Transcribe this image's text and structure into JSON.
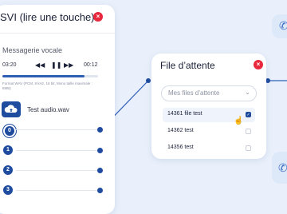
{
  "svi": {
    "title": "SVI (lire une touche)",
    "close_icon": "×",
    "voicemail_label": "Messagerie vocale",
    "time_start": "03:20",
    "time_end": "00:12",
    "progress": 0.86,
    "format_text": "Format WAV (PCM, 8 kHz, 16 bit, Mono taille maximale : 8MB)",
    "file_name": "Test audio.wav",
    "keys": [
      "0",
      "1",
      "2",
      "3"
    ],
    "controls": {
      "prev": "◀◀",
      "pause": "❚❚",
      "next": "▶▶"
    }
  },
  "queue": {
    "title": "File d’attente",
    "close_icon": "×",
    "select_placeholder": "Mes files d’attente",
    "chevron": "⌄",
    "options": [
      {
        "label": "14361 file test",
        "checked": true
      },
      {
        "label": "14362 test",
        "checked": false
      },
      {
        "label": "14356 test",
        "checked": false
      }
    ]
  },
  "colors": {
    "accent": "#1f4c9e",
    "close": "#e8283c",
    "background": "#e9f0fb"
  }
}
